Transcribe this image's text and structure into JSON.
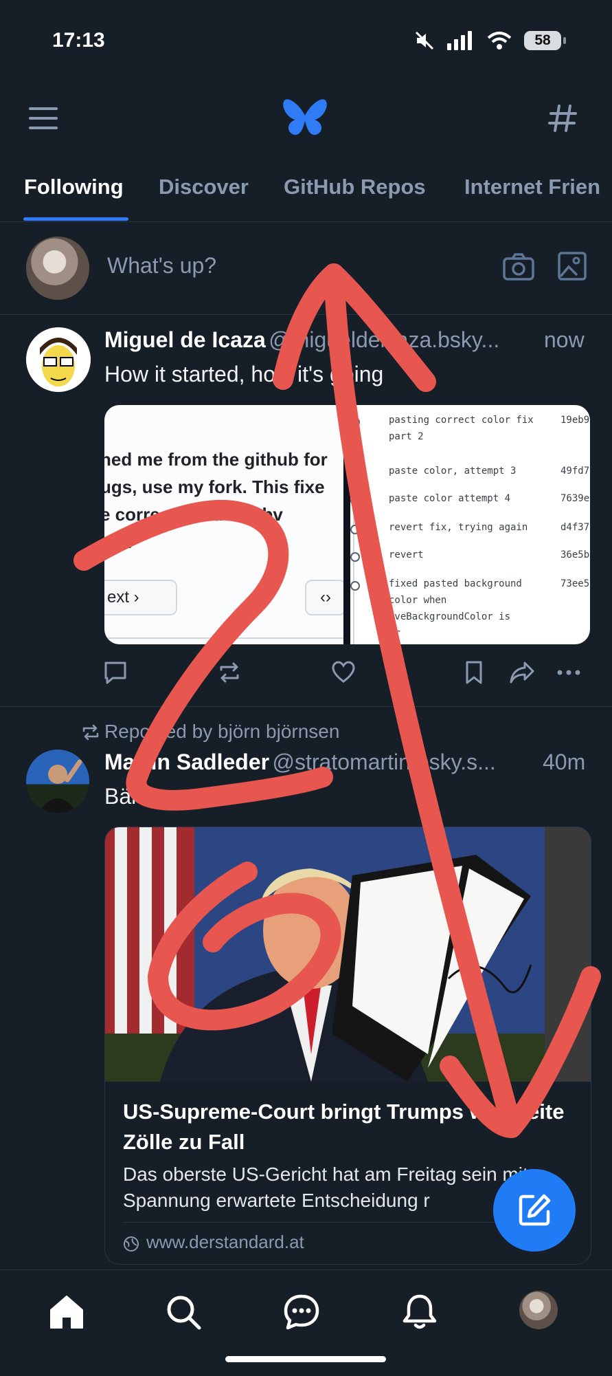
{
  "status_bar": {
    "time": "17:13",
    "battery": "58"
  },
  "header": {
    "menu_icon": "hamburger-icon",
    "logo_icon": "butterfly-logo",
    "feeds_icon": "hashtag-icon"
  },
  "tabs": [
    "Following",
    "Discover",
    "GitHub Repos",
    "Internet Frien"
  ],
  "composer": {
    "placeholder": "What's up?"
  },
  "posts": [
    {
      "author": "Miguel de Icaza",
      "handle": "@migueldeicaza.bsky...",
      "time": "now",
      "text": "How it started, how it's going",
      "embed": {
        "left_lines": [
          "hed me from the github for",
          "ugs, use my fork.  This fixe",
          "e correct    another obv",
          "ars."
        ],
        "left_button": "ext",
        "commits": [
          {
            "msg": "pasting correct color fix",
            "msg2": "part 2",
            "hash": "19eb9"
          },
          {
            "msg": "paste color, attempt 3",
            "hash": "49fd7"
          },
          {
            "msg": "paste color attempt 4",
            "hash": "7639e"
          },
          {
            "msg": "revert fix, trying again",
            "hash": "d4f37"
          },
          {
            "msg": "revert",
            "hash": "36e5b"
          },
          {
            "msg": "fixed pasted background",
            "msg2": "color when",
            "msg3": "iveBackgroundColor is",
            "msg4": "ar",
            "hash": "73ee5"
          }
        ]
      }
    },
    {
      "repost_label": "Reposted by björn björnsen",
      "author": "Martin Sadleder",
      "handle": "@stratomartin.bsky.s...",
      "time": "40m",
      "text": "Bäm",
      "link_card": {
        "title": "US-Supreme-Court bringt Trumps weltweite Zölle zu Fall",
        "description": "Das oberste US-Gericht hat am Freitag sein mit Spannung erwartete Entscheidung r",
        "domain": "www.derstandard.at"
      }
    }
  ],
  "bottom_nav": [
    "home-icon",
    "search-icon",
    "chat-icon",
    "bell-icon",
    "profile-avatar"
  ],
  "colors": {
    "background": "#161e27",
    "accent": "#2f7cf6",
    "muted": "#8b9ab0",
    "annotation": "#e8574f"
  }
}
